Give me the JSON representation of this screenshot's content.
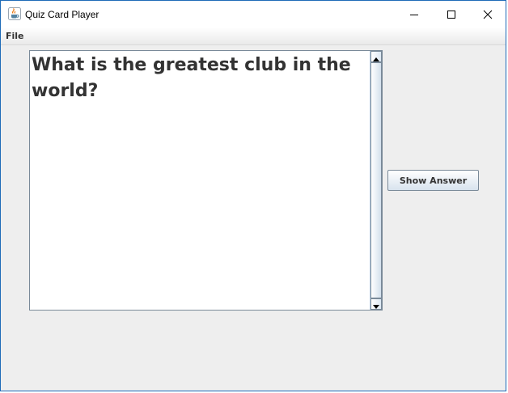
{
  "window": {
    "title": "Quiz Card Player",
    "app_icon": "java-cup-icon",
    "controls": {
      "minimize_icon": "minimize-icon",
      "maximize_icon": "maximize-icon",
      "close_icon": "close-icon"
    }
  },
  "menubar": {
    "items": [
      {
        "label": "File"
      }
    ]
  },
  "question": {
    "text": "What is the greatest club in the world?"
  },
  "buttons": {
    "show_answer_label": "Show Answer"
  },
  "colors": {
    "window_border": "#1e6bb8",
    "panel_background": "#eeeeee",
    "text": "#333333"
  }
}
